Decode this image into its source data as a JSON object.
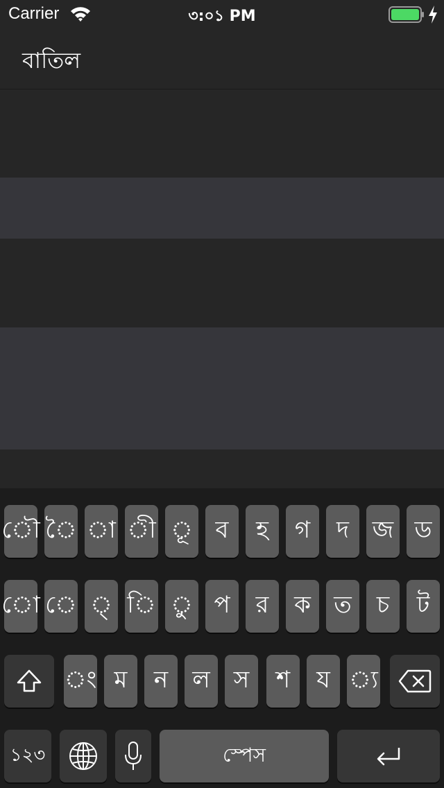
{
  "status_bar": {
    "carrier": "Carrier",
    "time": "৩:০১ PM",
    "battery_level": 1.0,
    "battery_color": "#4cd964"
  },
  "nav": {
    "cancel_label": "বাতিল"
  },
  "keyboard": {
    "row1": [
      "ৌ",
      "ৈ",
      "া",
      "ী",
      "ূ",
      "ব",
      "হ",
      "গ",
      "দ",
      "জ",
      "ড"
    ],
    "row2": [
      "ো",
      "ে",
      "্",
      "ি",
      "ু",
      "প",
      "র",
      "ক",
      "ত",
      "চ",
      "ট"
    ],
    "row3": [
      "ং",
      "ম",
      "ন",
      "ল",
      "স",
      "শ",
      "য",
      "্য"
    ],
    "numbers_label": "১২৩",
    "space_label": "স্পেস",
    "icons": [
      "shift-icon",
      "backspace-icon",
      "globe-icon",
      "microphone-icon",
      "return-icon"
    ]
  }
}
